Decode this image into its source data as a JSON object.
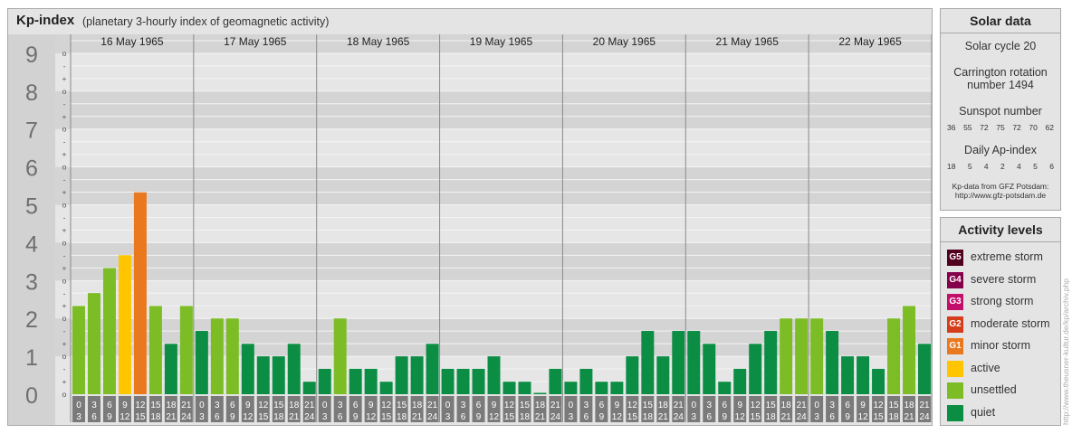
{
  "header": {
    "title": "Kp-index",
    "subtitle": "(planetary 3-hourly index of geomagnetic activity)"
  },
  "chart_data": {
    "type": "bar",
    "days": [
      "16 May 1965",
      "17 May 1965",
      "18 May 1965",
      "19 May 1965",
      "20 May 1965",
      "21 May 1965",
      "22 May 1965"
    ],
    "hour_labels": [
      [
        "0",
        "3"
      ],
      [
        "3",
        "6"
      ],
      [
        "6",
        "9"
      ],
      [
        "9",
        "12"
      ],
      [
        "12",
        "15"
      ],
      [
        "15",
        "18"
      ],
      [
        "18",
        "21"
      ],
      [
        "21",
        "24"
      ]
    ],
    "values": [
      2.33,
      2.67,
      3.33,
      3.67,
      5.33,
      2.33,
      1.33,
      2.33,
      1.67,
      2.0,
      2.0,
      1.33,
      1.0,
      1.0,
      1.33,
      0.33,
      0.67,
      2.0,
      0.67,
      0.67,
      0.33,
      1.0,
      1.0,
      1.33,
      0.67,
      0.67,
      0.67,
      1.0,
      0.33,
      0.33,
      0.0,
      0.67,
      0.33,
      0.67,
      0.33,
      0.33,
      1.0,
      1.67,
      1.0,
      1.67,
      1.67,
      1.33,
      0.33,
      0.67,
      1.33,
      1.67,
      2.0,
      2.0,
      2.0,
      1.67,
      1.0,
      1.0,
      0.67,
      2.0,
      2.33,
      1.33
    ],
    "y_ticks": [
      "0",
      "1",
      "2",
      "3",
      "4",
      "5",
      "6",
      "7",
      "8",
      "9"
    ],
    "sub_ticks": [
      "o",
      "+",
      "-"
    ],
    "ylim": [
      0,
      9
    ],
    "colors": {
      "quiet": "#0b8d44",
      "unsettled": "#7cbd26",
      "active": "#fec500",
      "minor": "#e9781e"
    }
  },
  "solar": {
    "title": "Solar data",
    "cycle": "Solar cycle 20",
    "carrington_1": "Carrington rotation",
    "carrington_2": "number 1494",
    "sunspot_title": "Sunspot number",
    "sunspots": [
      "36",
      "55",
      "72",
      "75",
      "72",
      "70",
      "62"
    ],
    "ap_title": "Daily Ap-index",
    "ap": [
      "18",
      "5",
      "4",
      "2",
      "4",
      "5",
      "6"
    ],
    "source_1": "Kp-data from GFZ Potsdam:",
    "source_2": "http://www.gfz-potsdam.de"
  },
  "levels": {
    "title": "Activity levels",
    "items": [
      {
        "code": "G5",
        "label": "extreme storm",
        "color": "#52001f"
      },
      {
        "code": "G4",
        "label": "severe storm",
        "color": "#85004a"
      },
      {
        "code": "G3",
        "label": "strong storm",
        "color": "#c30e6a"
      },
      {
        "code": "G2",
        "label": "moderate storm",
        "color": "#d53c1a"
      },
      {
        "code": "G1",
        "label": "minor storm",
        "color": "#e9781e"
      },
      {
        "code": "",
        "label": "active",
        "color": "#fec500"
      },
      {
        "code": "",
        "label": "unsettled",
        "color": "#7cbd26"
      },
      {
        "code": "",
        "label": "quiet",
        "color": "#0b8d44"
      }
    ]
  },
  "credit": "http://www.theusner-kultur.de/kp/archiv.php"
}
